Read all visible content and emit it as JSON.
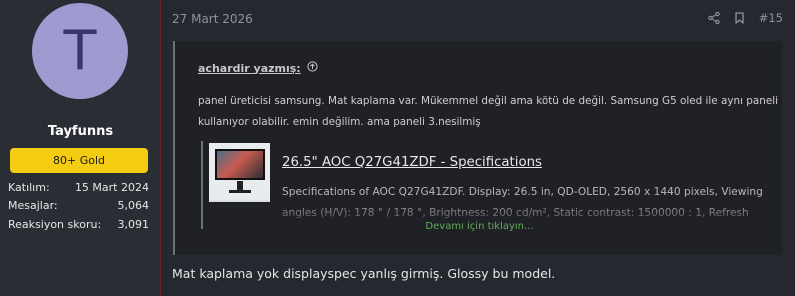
{
  "user": {
    "avatar_letter": "T",
    "avatar_color": "#9f9ad0",
    "username": "Tayfunns",
    "badge": "80+ Gold",
    "badge_color": "#f4cc12",
    "stats": [
      {
        "label": "Katılım:",
        "value": "15 Mart 2024"
      },
      {
        "label": "Mesajlar:",
        "value": "5,064"
      },
      {
        "label": "Reaksiyon skoru:",
        "value": "3,091"
      }
    ]
  },
  "post": {
    "date": "27 Mart 2026",
    "number": "#15",
    "actions": [
      "share-icon",
      "bookmark-icon"
    ],
    "quote": {
      "author": "achardir yazmış:",
      "icon": "arrow-up-circle-icon",
      "text": "panel üreticisi samsung. Mat kaplama var. Mükemmel değil ama kötü de değil. Samsung G5 oled ile aynı paneli kullanıyor olabilir. emin değilim. ama paneli 3.nesilmiş",
      "preview": {
        "title": "26.5\" AOC Q27G41ZDF - Specifications",
        "description": "Specifications of AOC Q27G41ZDF. Display: 26.5 in, QD-OLED, 2560 x 1440 pixels, Viewing angles (H/V): 178 ° / 178 °, Brightness: 200 cd/m², Static contrast: 1500000 : 1, Refresh"
      },
      "expand_label": "Devamı için tıklayın..."
    },
    "reply_text": "Mat kaplama yok displayspec yanlış girmiş. Glossy bu model.",
    "accent_color": "#5fae59"
  }
}
